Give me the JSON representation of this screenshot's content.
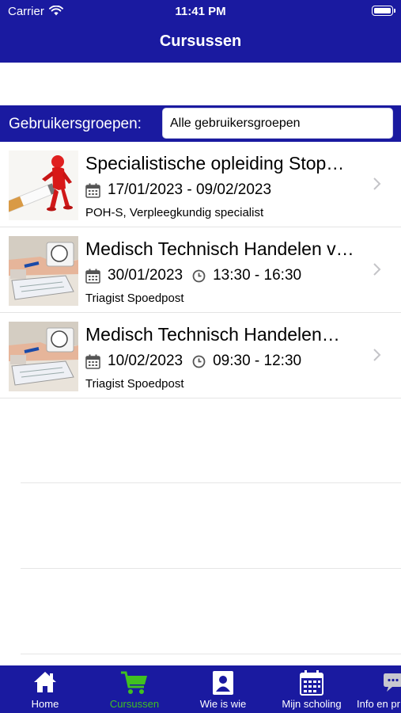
{
  "status_bar": {
    "carrier": "Carrier",
    "time": "11:41 PM"
  },
  "header": {
    "title": "Cursussen"
  },
  "filter": {
    "label": "Gebruikersgroepen:",
    "value": "Alle gebruikersgroepen"
  },
  "courses": [
    {
      "title": "Specialistische opleiding Stop…",
      "dates": "17/01/2023 - 09/02/2023",
      "time": "",
      "group": "POH-S, Verpleegkundig specialist",
      "thumb": "stop-smoking-figure"
    },
    {
      "title": "Medisch Technisch Handelen v…",
      "dates": "30/01/2023",
      "time": "13:30 - 16:30",
      "group": "Triagist Spoedpost",
      "thumb": "blood-pressure-photo"
    },
    {
      "title": " Medisch Technisch Handelen…",
      "dates": "10/02/2023",
      "time": "09:30 - 12:30",
      "group": "Triagist Spoedpost",
      "thumb": "blood-pressure-photo"
    }
  ],
  "tabs": [
    {
      "label": "Home",
      "icon": "home-icon"
    },
    {
      "label": "Cursussen",
      "icon": "cart-icon",
      "active": true
    },
    {
      "label": "Wie is wie",
      "icon": "person-icon"
    },
    {
      "label": "Mijn scholing",
      "icon": "calendar-icon"
    },
    {
      "label": "Info en pr",
      "icon": "chat-icon"
    }
  ],
  "colors": {
    "brand": "#1a1aa0",
    "active_tab": "#40c020"
  }
}
